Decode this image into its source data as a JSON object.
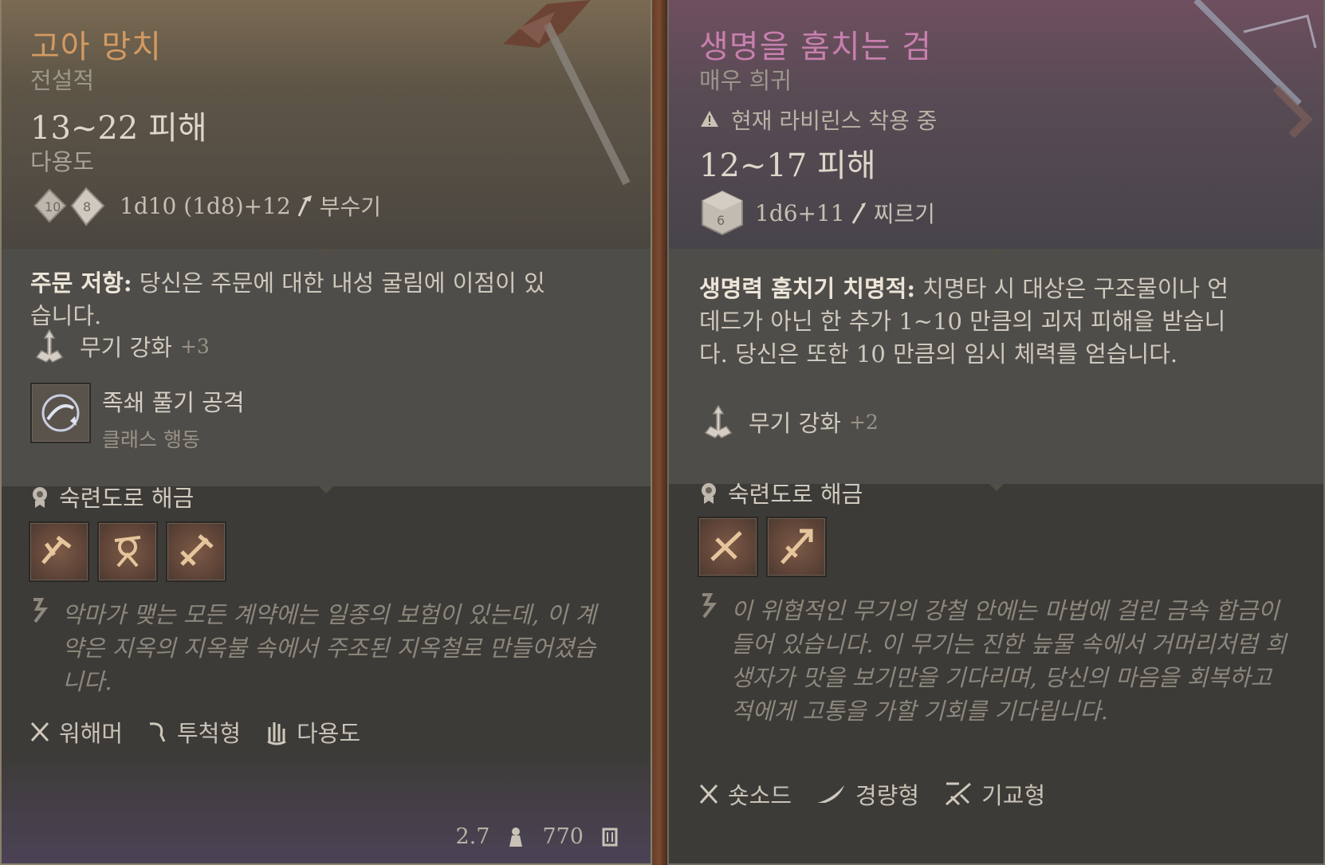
{
  "left_card": {
    "title": "고아 망치",
    "rarity": "전설적",
    "damage": "13~22 피해",
    "damage_sub": "다용도",
    "dice_faces": [
      "10",
      "8"
    ],
    "dice_formula": "1d10 (1d8)+12",
    "damage_type": "부수기",
    "description_bold": "주문 저항:",
    "description": " 당신은 주문에 대한 내성 굴림에 이점이 있습니다.",
    "enchant_label": "무기 강화",
    "enchant_bonus": "+3",
    "action_name": "족쇄 풀기 공격",
    "action_sub": "클래스 행동",
    "mastery_label": "숙련도로 해금",
    "mastery_icon_names": [
      "sunder-icon",
      "topple-icon",
      "cleave-icon"
    ],
    "flavor": "악마가 맺는 모든 계약에는 일종의 보험이 있는데, 이 계약은 지옥의 지옥불 속에서 주조된 지옥철로 만들어졌습니다.",
    "properties": [
      {
        "icon": "warhammer-icon",
        "label": "워해머"
      },
      {
        "icon": "thrown-icon",
        "label": "투척형"
      },
      {
        "icon": "versatile-icon",
        "label": "다용도"
      }
    ],
    "weight": "2.7",
    "value": "770"
  },
  "right_card": {
    "title": "생명을 훔치는 검",
    "rarity": "매우 희귀",
    "equipped_notice": "현재 라비린스 착용 중",
    "damage": "12~17 피해",
    "dice_faces": [
      "6"
    ],
    "dice_formula": "1d6+11",
    "damage_type": "찌르기",
    "description_bold": "생명력 훔치기 치명적:",
    "description": " 치명타 시 대상은 구조물이나 언데드가 아닌 한 추가 1~10 만큼의 괴저 피해을 받습니다. 당신은 또한 10 만큼의 임시 체력를 얻습니다.",
    "enchant_label": "무기 강화",
    "enchant_bonus": "+2",
    "mastery_label": "숙련도로 해금",
    "mastery_icon_names": [
      "slash-icon",
      "piercing-strike-icon"
    ],
    "flavor": "이 위협적인 무기의 강철 안에는 마법에 걸린 금속 합금이 들어 있습니다. 이 무기는 진한 늪물 속에서 거머리처럼 희생자가 맛을 보기만을 기다리며, 당신의 마음을 회복하고 적에게 고통을 가할 기회를 기다립니다.",
    "properties": [
      {
        "icon": "shortsword-icon",
        "label": "숏소드"
      },
      {
        "icon": "light-icon",
        "label": "경량형"
      },
      {
        "icon": "finesse-icon",
        "label": "기교형"
      }
    ]
  },
  "colors": {
    "legendary_title": "#d39a62",
    "very_rare_title": "#c77fae"
  }
}
